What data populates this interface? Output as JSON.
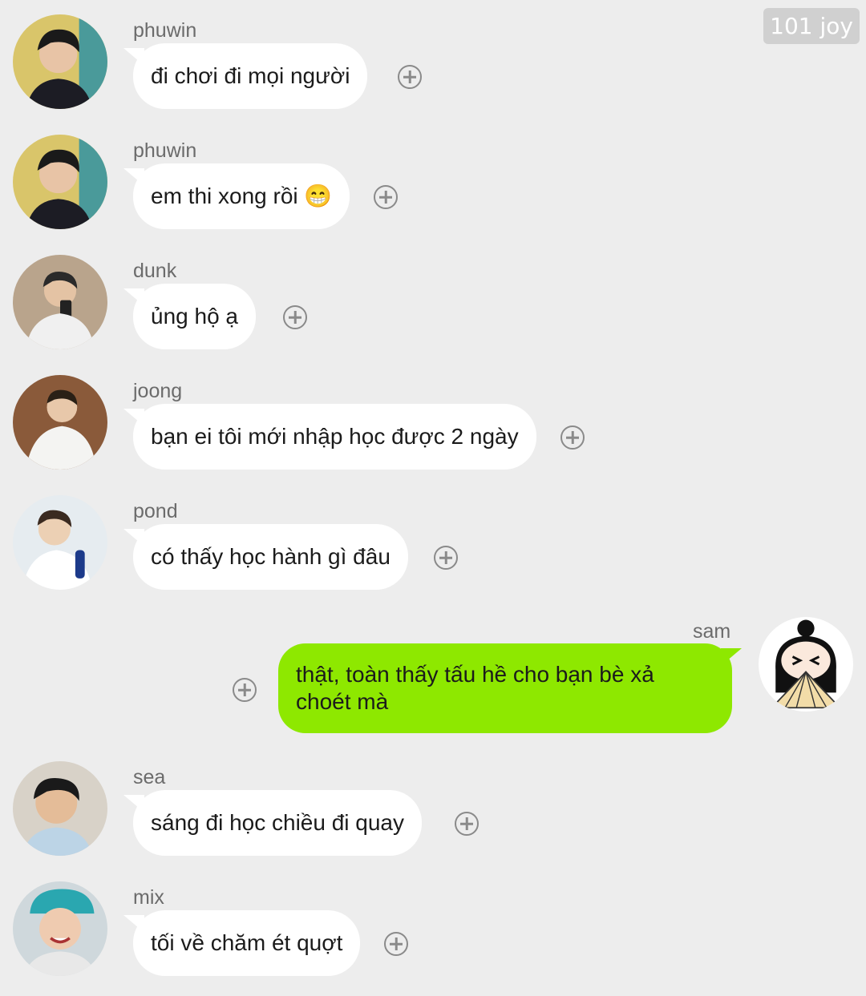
{
  "watermark": "101 joy",
  "messages": [
    {
      "sender": "phuwin",
      "text": "đi chơi đi mọi người",
      "avatar_icon": "person-avatar-phuwin"
    },
    {
      "sender": "phuwin",
      "text": "em thi xong rồi 😁",
      "avatar_icon": "person-avatar-phuwin"
    },
    {
      "sender": "dunk",
      "text": "ủng hộ ạ",
      "avatar_icon": "person-avatar-dunk"
    },
    {
      "sender": "joong",
      "text": "bạn ei tôi mới nhập học được 2 ngày",
      "avatar_icon": "person-avatar-joong"
    },
    {
      "sender": "pond",
      "text": "có thấy học hành gì đâu",
      "avatar_icon": "person-avatar-pond"
    },
    {
      "sender": "sam",
      "text": "thật, toàn thấy tấu hề cho bạn bè xả choét mà",
      "avatar_icon": "cartoon-avatar-sam",
      "outgoing": true
    },
    {
      "sender": "sea",
      "text": "sáng đi học chiều đi quay",
      "avatar_icon": "person-avatar-sea"
    },
    {
      "sender": "mix",
      "text": "tối về chăm ét quợt",
      "avatar_icon": "person-avatar-mix"
    }
  ],
  "colors": {
    "background": "#ededed",
    "incoming_bubble": "#ffffff",
    "outgoing_bubble": "#8ee800"
  }
}
